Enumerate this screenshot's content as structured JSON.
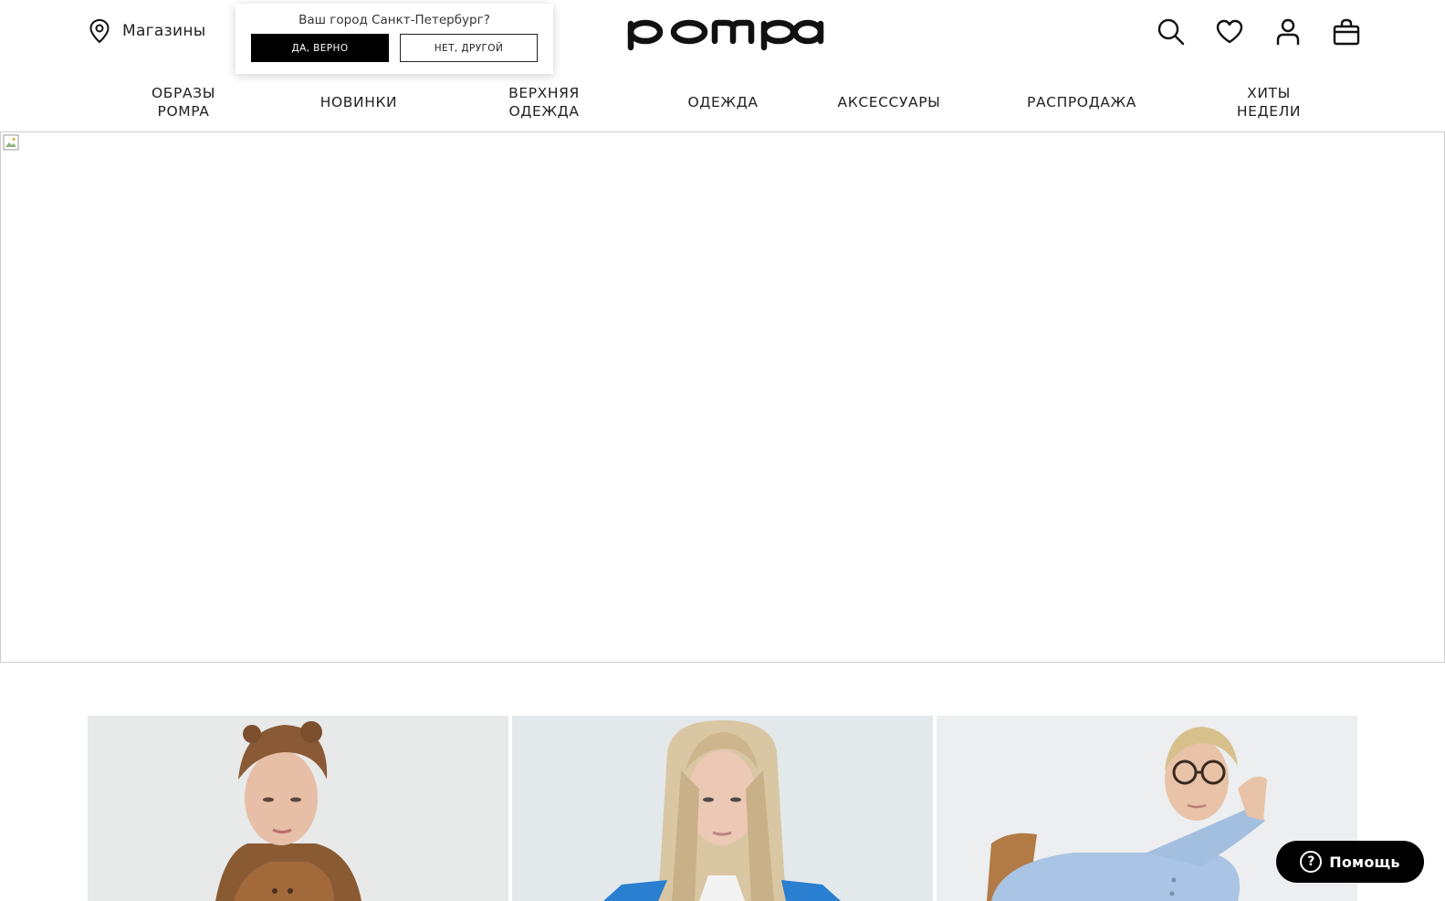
{
  "header": {
    "stores_label": "Магазины",
    "logo_text": "pompa",
    "icons": [
      "search-icon",
      "heart-icon",
      "user-icon",
      "bag-icon"
    ]
  },
  "city_popup": {
    "question": "Ваш город Санкт-Петербург?",
    "yes_label": "ДА, ВЕРНО",
    "no_label": "НЕТ, ДРУГОЙ"
  },
  "nav": {
    "items": [
      {
        "label": "ОБРАЗЫ POMPA"
      },
      {
        "label": "НОВИНКИ"
      },
      {
        "label": "ВЕРХНЯЯ ОДЕЖДА"
      },
      {
        "label": "ОДЕЖДА"
      },
      {
        "label": "АКСЕССУАРЫ"
      },
      {
        "label": "РАСПРОДАЖА"
      },
      {
        "label": "ХИТЫ НЕДЕЛИ"
      }
    ]
  },
  "help": {
    "label": "Помощь",
    "icon": "question-icon"
  },
  "colors": {
    "accent": "#000000",
    "border": "#cfcfcf",
    "card_bg_1": "#e9eaea",
    "card_bg_2": "#e4e9ea",
    "card_bg_3": "#edeff0"
  }
}
